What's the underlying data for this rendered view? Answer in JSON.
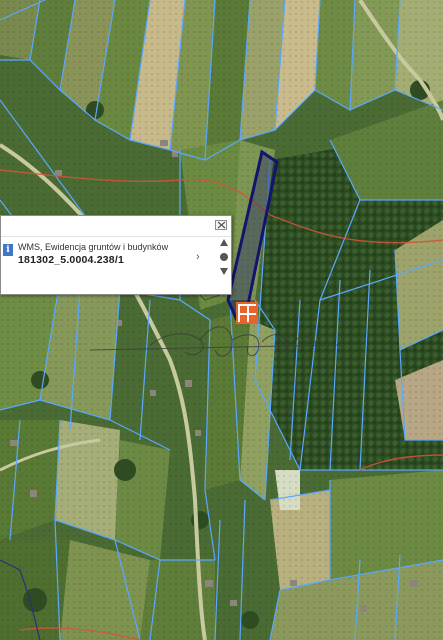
{
  "map": {
    "base_color": "#3d5a2a",
    "parcel_line_color": "#5aa8ff",
    "selected_parcel_color": "#14146e",
    "road_color": "#c9c9a0",
    "boundary_color": "#d4553a",
    "marker_color": "#e8632a"
  },
  "popup": {
    "layer_name": "WMS, Ewidencja gruntów i budynków",
    "parcel_id": "181302_5.0004.238/1",
    "info_icon": "info-icon",
    "close_icon": "close-icon",
    "next_icon": "chevron-right-icon"
  },
  "marker": {
    "icon": "feature-marker-icon"
  },
  "watermark": {
    "type": "signature"
  }
}
